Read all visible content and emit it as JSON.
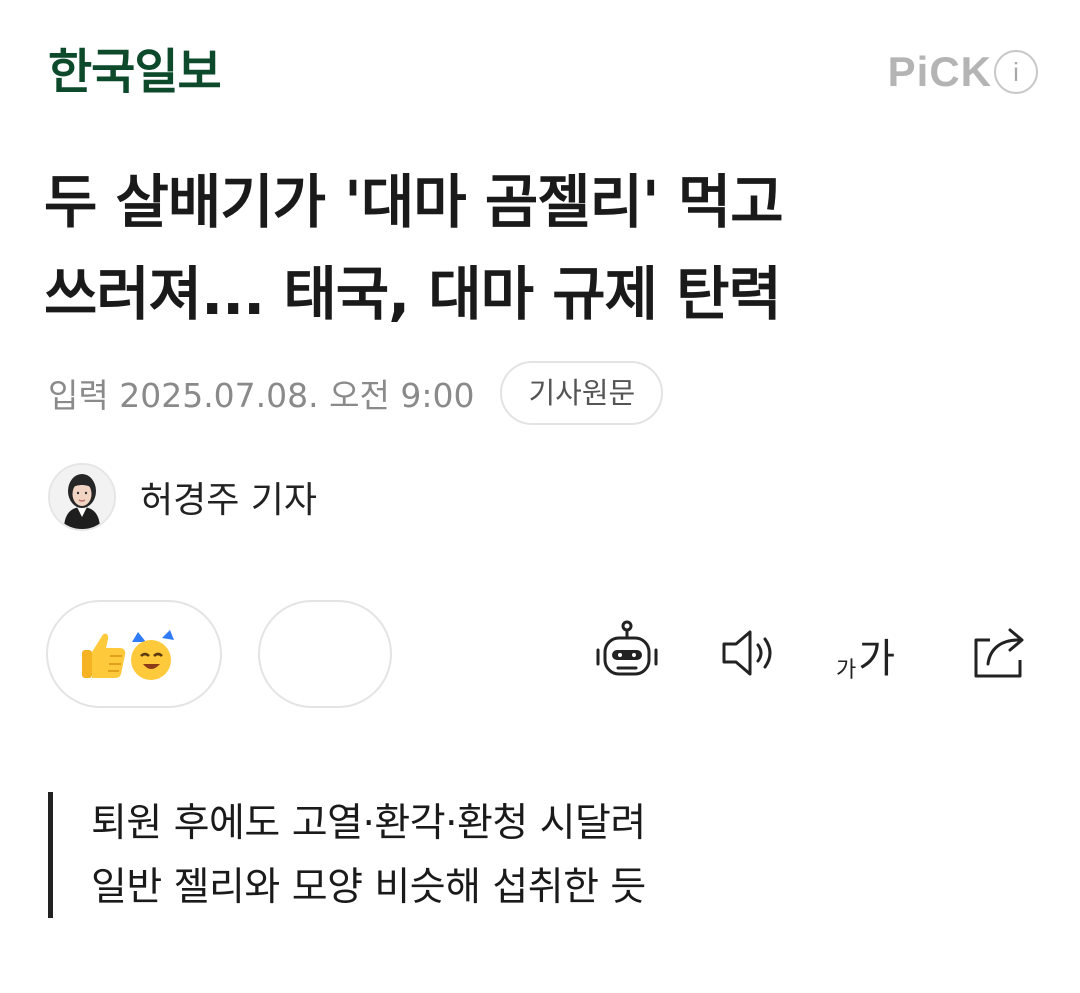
{
  "header": {
    "brand": "한국일보",
    "pick_label": "PiCK",
    "info_icon_text": "i"
  },
  "article": {
    "headline_line1": "두 살배기가 '대마 곰젤리' 먹고",
    "headline_line2": "쓰러져... 태국, 대마 규제 탄력",
    "date": "입력 2025.07.08. 오전 9:00",
    "original_button": "기사원문",
    "author": "허경주 기자",
    "summary_line1": "퇴원 후에도 고열·환각·환청 시달려",
    "summary_line2": "일반 젤리와 모양 비슷해 섭취한 듯"
  },
  "toolbar": {
    "font_small": "가",
    "font_large": "가",
    "icons": [
      "reaction-thumbs-up-emoji",
      "reaction-cheer-emoji",
      "robot-icon",
      "speaker-icon",
      "font-size-icon",
      "share-icon"
    ]
  },
  "colors": {
    "brand": "#0d4a2c",
    "pick": "#b4b4b4",
    "meta_text": "#8a8a8a"
  }
}
